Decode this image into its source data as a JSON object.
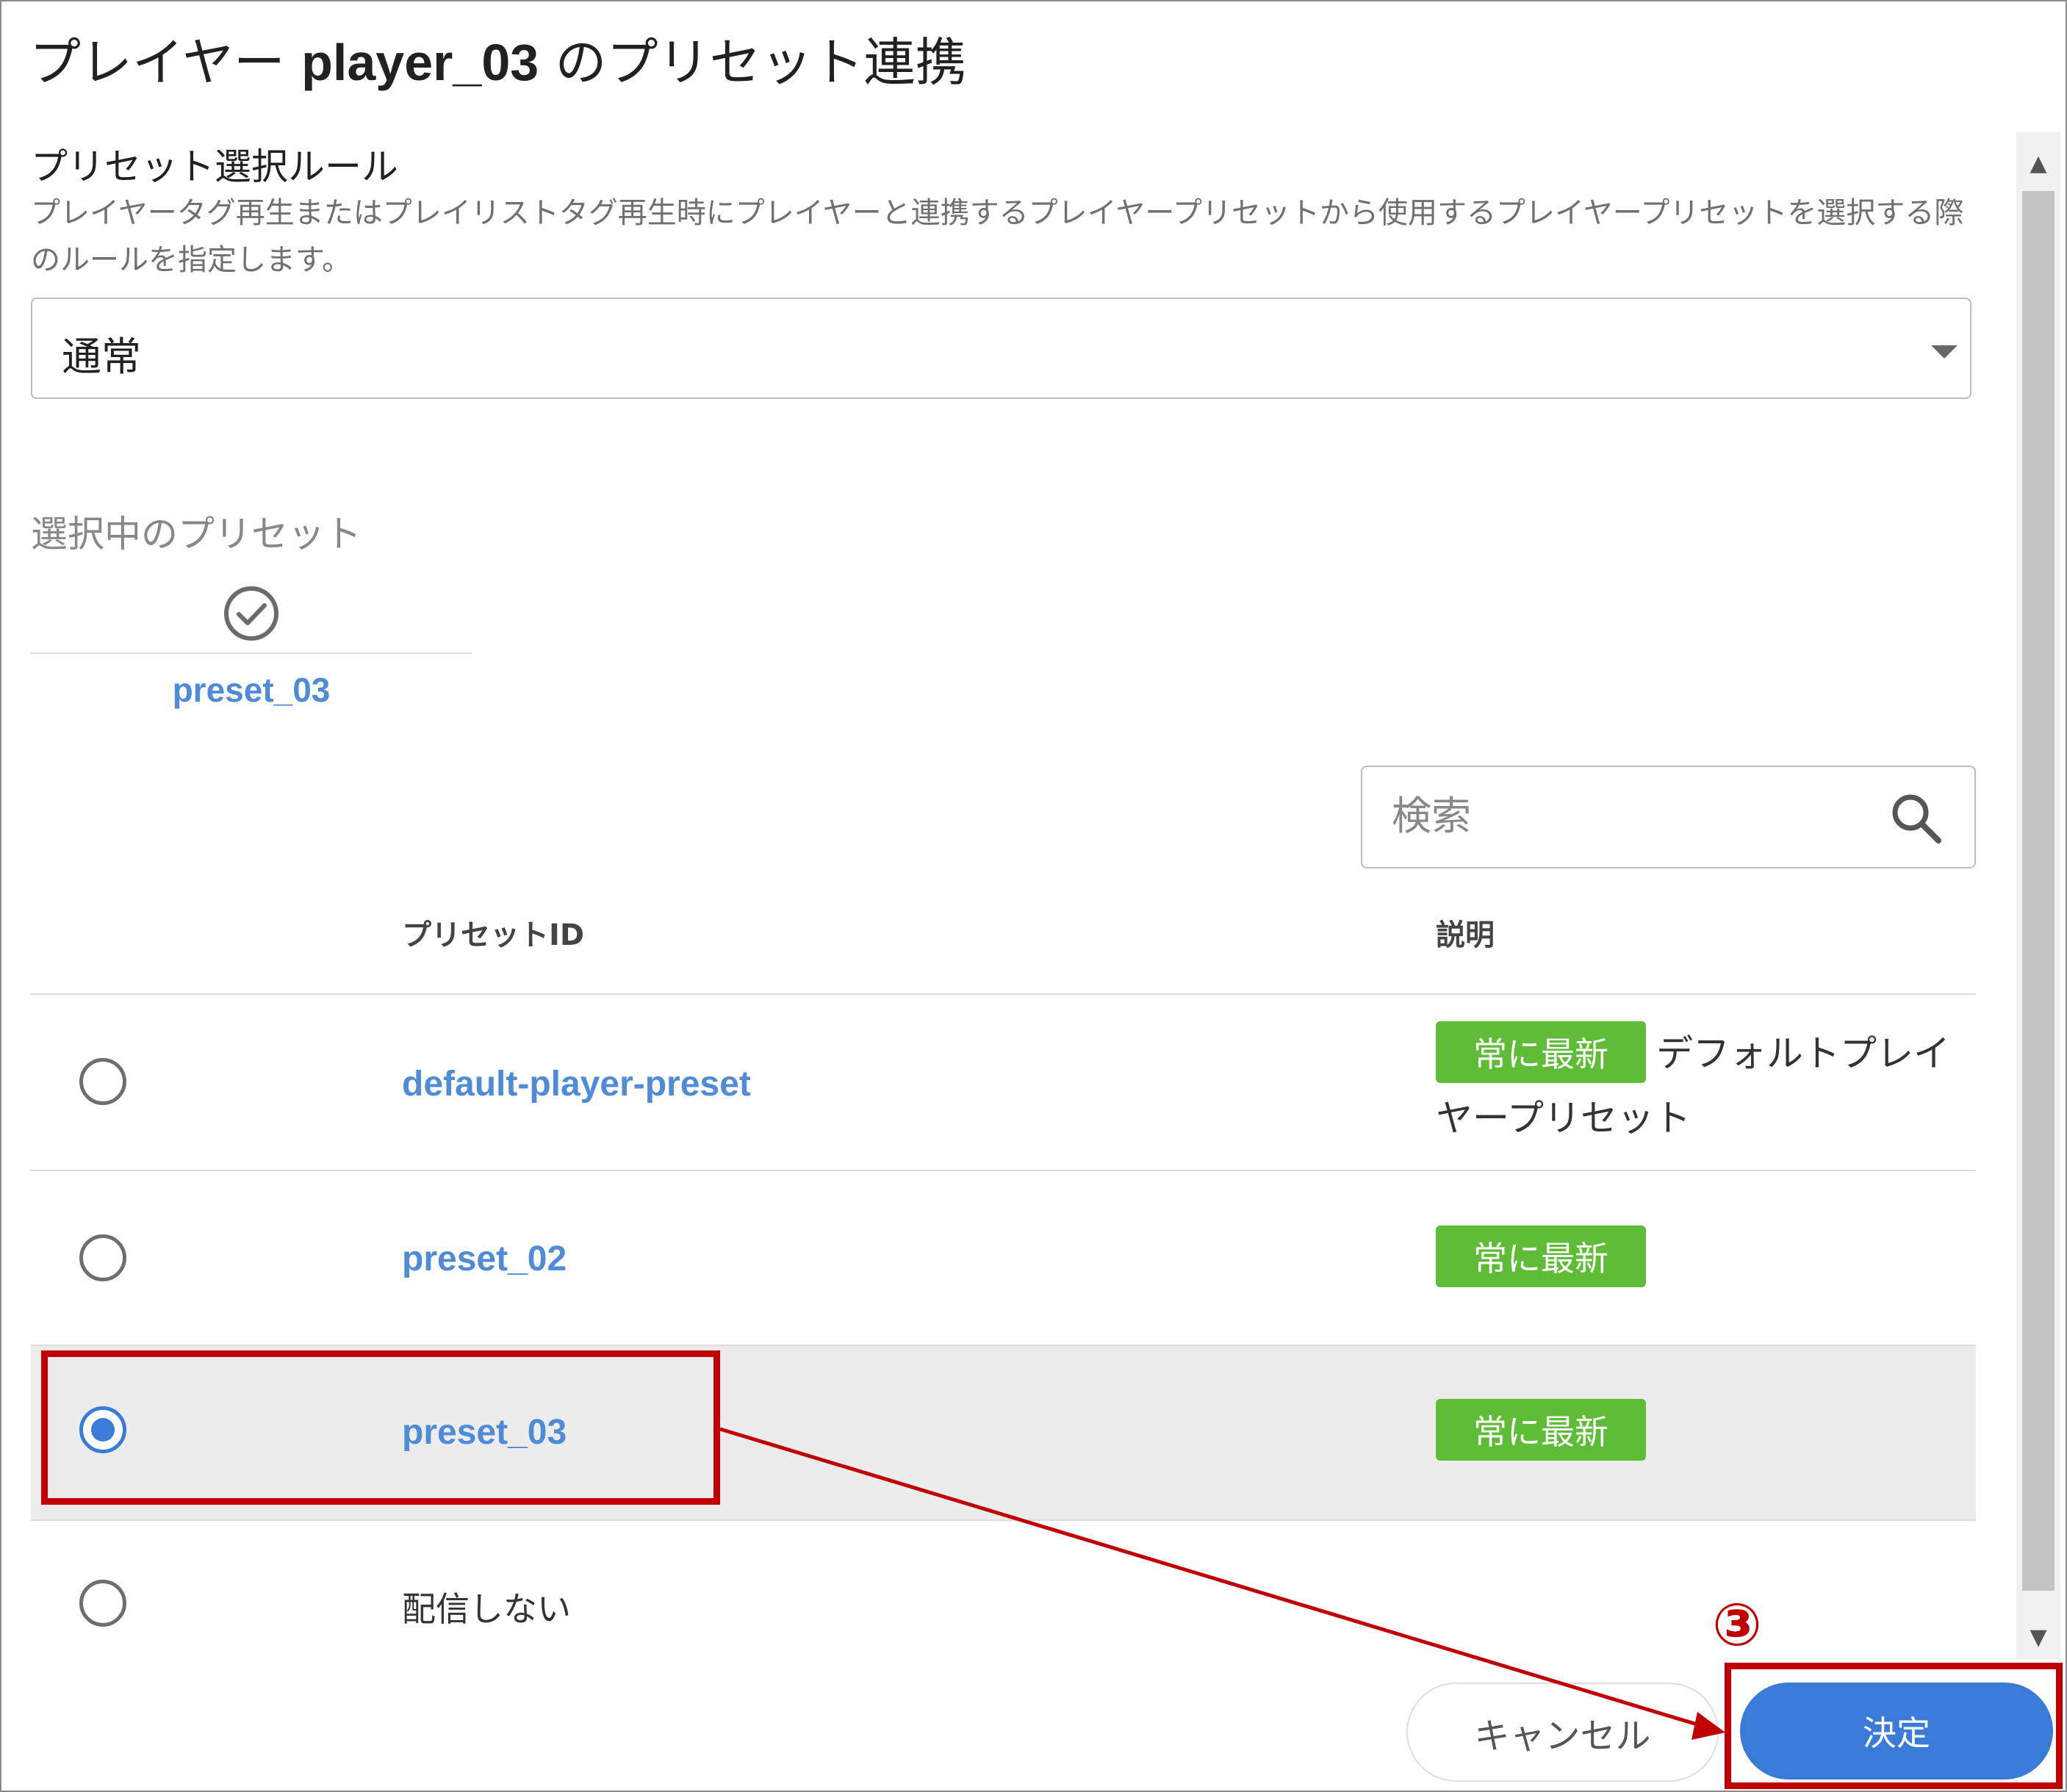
{
  "dialog": {
    "title_prefix": "プレイヤー ",
    "player_id": "player_03",
    "title_suffix": " のプリセット連携"
  },
  "rule": {
    "label": "プリセット選択ルール",
    "help": "プレイヤータグ再生またはプレイリストタグ再生時にプレイヤーと連携するプレイヤープリセットから使用するプレイヤープリセットを選択する際のルールを指定します。",
    "selected_value": "通常"
  },
  "selected_preset": {
    "caption": "選択中のプリセット",
    "value": "preset_03"
  },
  "search": {
    "placeholder": "検索"
  },
  "table": {
    "columns": [
      "プリセットID",
      "説明"
    ],
    "badge_label": "常に最新",
    "rows": [
      {
        "id": "default-player-preset",
        "badge": "常に最新",
        "description": "デフォルトプレイヤープリセット",
        "checked": false
      },
      {
        "id": "preset_02",
        "badge": "常に最新",
        "description": "",
        "checked": false
      },
      {
        "id": "preset_03",
        "badge": "常に最新",
        "description": "",
        "checked": true
      },
      {
        "id": "配信しない",
        "badge": "",
        "description": "",
        "checked": false
      }
    ]
  },
  "footer": {
    "cancel_label": "キャンセル",
    "confirm_label": "決定"
  },
  "annotation": {
    "step_marker": "③",
    "color": "#c00000"
  },
  "colors": {
    "accent": "#3b7bd8",
    "link": "#4f8bd6",
    "badge": "#5fbc36",
    "selected_row": "#ececec"
  }
}
